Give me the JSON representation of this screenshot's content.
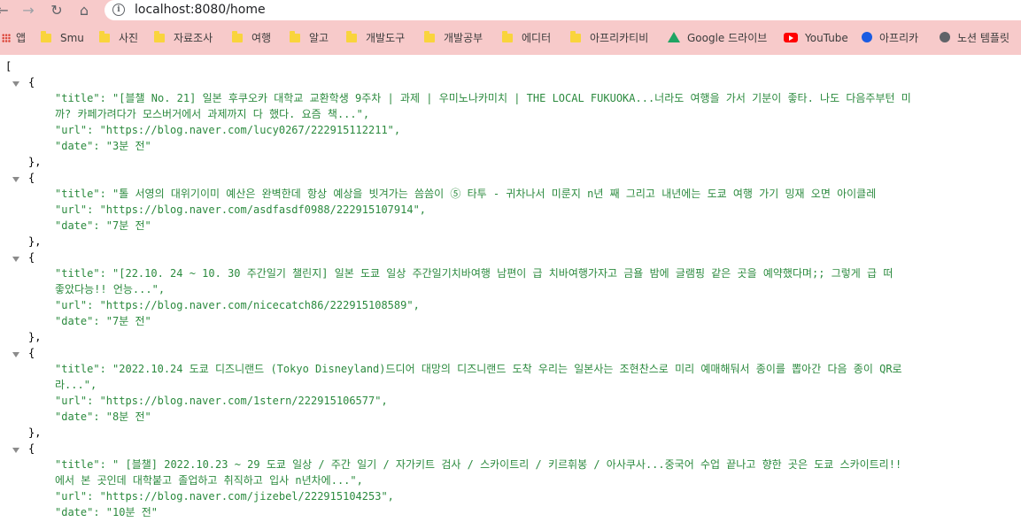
{
  "browser": {
    "url": "localhost:8080/home",
    "bookmarks": [
      {
        "label": "앱",
        "icon": "apps-icon"
      },
      {
        "label": "Smu",
        "icon": "folder-icon"
      },
      {
        "label": "사진",
        "icon": "folder-icon"
      },
      {
        "label": "자료조사",
        "icon": "folder-icon"
      },
      {
        "label": "여행",
        "icon": "folder-icon"
      },
      {
        "label": "알고",
        "icon": "folder-icon"
      },
      {
        "label": "개발도구",
        "icon": "folder-icon"
      },
      {
        "label": "개발공부",
        "icon": "folder-icon"
      },
      {
        "label": "에디터",
        "icon": "folder-icon"
      },
      {
        "label": "아프리카티비",
        "icon": "folder-icon"
      },
      {
        "label": "Google 드라이브",
        "icon": "google-drive-icon"
      },
      {
        "label": "YouTube",
        "icon": "youtube-icon"
      },
      {
        "label": "아프리카",
        "icon": "afreeca-icon"
      },
      {
        "label": "노션 템플릿",
        "icon": "globe-icon"
      }
    ]
  },
  "json_view": {
    "open_bracket": "[",
    "entries": [
      {
        "title_line1": "\"title\": \"[블챌 No. 21] 일본 후쿠오카 대학교 교환학생 9주차 | 과제 | 우미노나카미치 | THE LOCAL FUKUOKA...너라도 여행을 가서 기분이 좋타. 나도 다음주부턴 미",
        "title_line2": "까? 카페가려다가 모스버거에서 과제까지 다 했다. 요즘 책...\",",
        "url": "\"url\": \"https://blog.naver.com/lucy0267/222915112211\",",
        "date": "\"date\": \"3분 전\""
      },
      {
        "title_line1": "\"title\": \"톨 서영의 대위기이미 예산은 완벽한데 항상 예상을 빗겨가는 씀씀이 ⑤ 타투 - 귀차나서 미룬지 n년 째 그리고 내년에는 도쿄 여행 가기 밍재 오면 아이클레",
        "title_line2": "",
        "url": "\"url\": \"https://blog.naver.com/asdfasdf0988/222915107914\",",
        "date": "\"date\": \"7분 전\""
      },
      {
        "title_line1": "\"title\": \"[22.10. 24 ~ 10. 30 주간일기 챌린지] 일본 도쿄 일상 주간일기치바여행 남편이 급 치바여행가자고 금욜 밤에 글램핑 같은 곳을 예약했다며;; 그렇게 급 떠",
        "title_line2": "좋았다능!! 언능...\",",
        "url": "\"url\": \"https://blog.naver.com/nicecatch86/222915108589\",",
        "date": "\"date\": \"7분 전\""
      },
      {
        "title_line1": "\"title\": \"2022.10.24 도쿄 디즈니랜드 (Tokyo Disneyland)드디어 대망의 디즈니랜드 도착 우리는 일본사는 조현찬스로 미리 예매해둬서 종이를 뽑아간 다음 종이 QR로",
        "title_line2": "라...\",",
        "url": "\"url\": \"https://blog.naver.com/1stern/222915106577\",",
        "date": "\"date\": \"8분 전\""
      },
      {
        "title_line1": "\"title\": \" [블챌] 2022.10.23 ~ 29 도쿄 일상 / 주간 일기 / 자가키트 검사 / 스카이트리 / 키르휘봉 / 아사쿠사...중국어 수업 끝나고 향한 곳은 도쿄 스카이트리!!",
        "title_line2": "에서 본 곳인데 대학붙고 졸업하고 취직하고 입사 n년차에...\",",
        "url": "\"url\": \"https://blog.naver.com/jizebel/222915104253\",",
        "date": "\"date\": \"10분 전\""
      }
    ],
    "open_brace": "{",
    "close_brace": "},"
  }
}
